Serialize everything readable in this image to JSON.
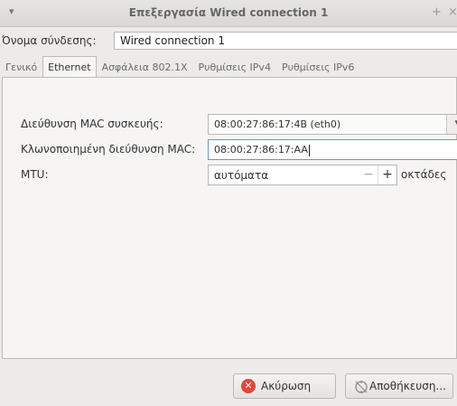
{
  "window": {
    "title": "Επεξεργασία Wired connection 1",
    "menu_glyph": "▾",
    "add_glyph": "+",
    "close_glyph": "×"
  },
  "connection": {
    "name_label": "Όνομα σύνδεσης:",
    "name_value": "Wired connection 1"
  },
  "tabs": [
    {
      "label": "Γενικό",
      "active": false
    },
    {
      "label": "Ethernet",
      "active": true
    },
    {
      "label": "Ασφάλεια 802.1X",
      "active": false
    },
    {
      "label": "Ρυθμίσεις IPv4",
      "active": false
    },
    {
      "label": "Ρυθμίσεις IPv6",
      "active": false
    }
  ],
  "ethernet": {
    "device_mac_label": "Διεύθυνση MAC συσκευής:",
    "device_mac_value": "08:00:27:86:17:4B (eth0)",
    "cloned_mac_label": "Κλωνοποιημένη διεύθυνση MAC:",
    "cloned_mac_value": "08:00:27:86:17:AA",
    "mtu_label": "MTU:",
    "mtu_value": "αυτόματα",
    "mtu_unit": "οκτάδες",
    "minus_glyph": "−",
    "plus_glyph": "+",
    "dropdown_glyph": "▼"
  },
  "buttons": {
    "cancel_label": "Ακύρωση",
    "save_label": "Αποθήκευση..."
  },
  "icons": {
    "cancel": "cancel-icon",
    "save": "save-icon"
  }
}
